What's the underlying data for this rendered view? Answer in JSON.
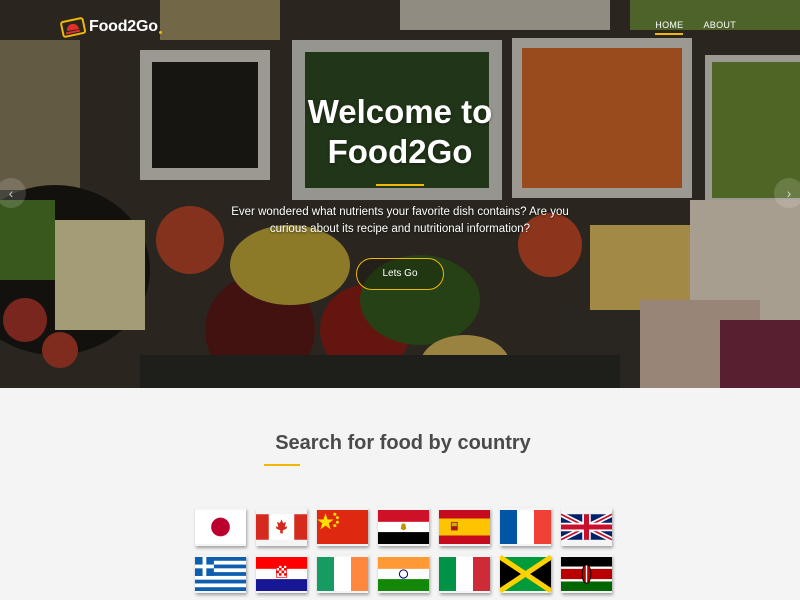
{
  "brand": {
    "name": "Food2Go"
  },
  "nav": {
    "items": [
      {
        "label": "HOME"
      },
      {
        "label": "ABOUT"
      }
    ]
  },
  "hero": {
    "title_line1": "Welcome to",
    "title_line2": "Food2Go",
    "text": "Ever wondered what nutrients your favorite dish contains? Are you curious about its recipe and nutritional information?",
    "cta_label": "Lets Go"
  },
  "carousel": {
    "prev_icon": "chevron-left-icon",
    "next_icon": "chevron-right-icon"
  },
  "countries": {
    "title": "Search for food by country",
    "flags": [
      {
        "icon": "flag-japan-icon"
      },
      {
        "icon": "flag-canada-icon"
      },
      {
        "icon": "flag-china-icon"
      },
      {
        "icon": "flag-egypt-icon"
      },
      {
        "icon": "flag-spain-icon"
      },
      {
        "icon": "flag-france-icon"
      },
      {
        "icon": "flag-uk-icon"
      },
      {
        "icon": "flag-greece-icon"
      },
      {
        "icon": "flag-croatia-icon"
      },
      {
        "icon": "flag-ireland-icon"
      },
      {
        "icon": "flag-india-icon"
      },
      {
        "icon": "flag-italy-icon"
      },
      {
        "icon": "flag-jamaica-icon"
      },
      {
        "icon": "flag-kenya-icon"
      }
    ]
  },
  "colors": {
    "accent": "#f2b705",
    "heading": "#4a4a4a",
    "section_bg": "#f4f4f4"
  }
}
